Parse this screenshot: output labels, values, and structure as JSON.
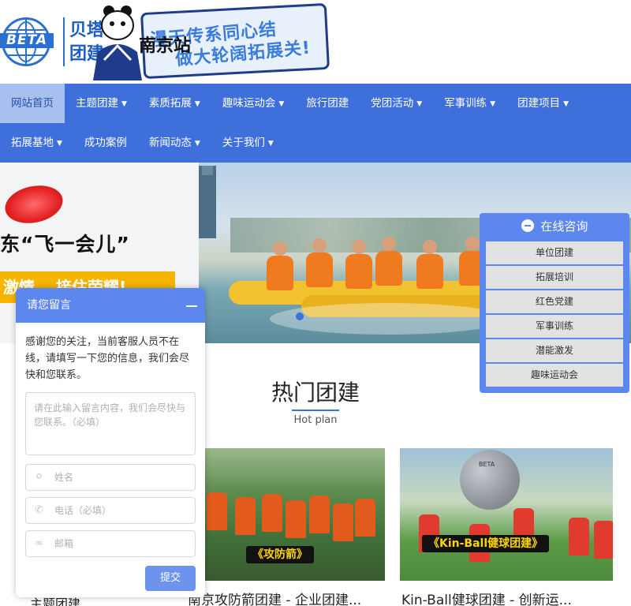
{
  "header": {
    "logo_text": "BETA",
    "brand_cn_line1": "贝塔",
    "brand_cn_line2": "团建",
    "station": "南京站",
    "slogan_line1": "漫天传系同心结",
    "slogan_line2": "做大轮阔拓展关!"
  },
  "nav": {
    "row1": [
      {
        "label": "网站首页",
        "active": true,
        "dropdown": false
      },
      {
        "label": "主题团建",
        "dropdown": true
      },
      {
        "label": "素质拓展",
        "dropdown": true
      },
      {
        "label": "趣味运动会",
        "dropdown": true
      },
      {
        "label": "旅行团建",
        "dropdown": false
      },
      {
        "label": "党团活动",
        "dropdown": true
      },
      {
        "label": "军事训练",
        "dropdown": true
      },
      {
        "label": "团建项目",
        "dropdown": true
      }
    ],
    "row2": [
      {
        "label": "拓展基地",
        "dropdown": true
      },
      {
        "label": "成功案例",
        "dropdown": false
      },
      {
        "label": "新闻动态",
        "dropdown": true
      },
      {
        "label": "关于我们",
        "dropdown": true
      }
    ],
    "caret": "▼"
  },
  "banner": {
    "title": "东“飞一会儿”",
    "strip_text": "激情，  接住荣耀!"
  },
  "section": {
    "title": "热门团建",
    "subtitle": "Hot plan"
  },
  "cards": [
    {
      "caption": "南京攻防箭团建 - 企业团建...",
      "ribbon": "《攻防箭》"
    },
    {
      "caption": "Kin-Ball健球团建 - 创新运...",
      "ribbon": "《Kin-Ball健球团建》",
      "ball_text": "BETA"
    }
  ],
  "chat": {
    "title": "请您留言",
    "intro": "感谢您的关注，当前客服人员不在线，请填写一下您的信息，我们会尽快和您联系。",
    "message_placeholder": "请在此输入留言内容，我们会尽快与您联系。（必填）",
    "name_placeholder": "姓名",
    "phone_placeholder": "电话（必填）",
    "email_placeholder": "邮箱",
    "submit": "提交",
    "behind_text": "主题团建"
  },
  "consult": {
    "title": "在线咨询",
    "items": [
      "单位团建",
      "拓展培训",
      "红色党建",
      "军事训练",
      "潜能激发",
      "趣味运动会"
    ]
  },
  "colors": {
    "nav_bg": "#3f6fdb",
    "nav_active": "#a8c0ef",
    "widget_blue": "#5b87ef",
    "accent_yellow": "#f7b400"
  }
}
